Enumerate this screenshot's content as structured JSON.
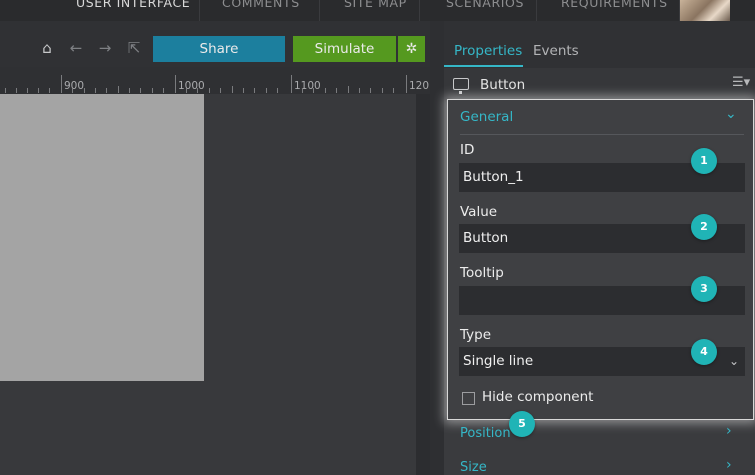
{
  "nav": {
    "tabs": [
      "USER INTERFACE",
      "COMMENTS",
      "SITE MAP",
      "SCENARIOS",
      "REQUIREMENTS"
    ],
    "active": "USER INTERFACE"
  },
  "toolbar": {
    "share_label": "Share",
    "simulate_label": "Simulate",
    "icons": [
      "home-icon",
      "back-arrow-icon",
      "forward-arrow-icon",
      "fit-to-screen-icon",
      "gear-icon"
    ]
  },
  "ruler": {
    "labels": [
      "900",
      "1000",
      "1100",
      "120"
    ]
  },
  "panel": {
    "tabs": [
      "Properties",
      "Events"
    ],
    "active_tab": "Properties",
    "component_name": "Button",
    "section_title": "General",
    "fields": {
      "id_label": "ID",
      "id_value": "Button_1",
      "value_label": "Value",
      "value_value": "Button",
      "tooltip_label": "Tooltip",
      "tooltip_value": "",
      "type_label": "Type",
      "type_value": "Single line",
      "hide_label": "Hide component",
      "hide_checked": false
    },
    "collapsed_sections": [
      "Position",
      "Size"
    ]
  },
  "badges": [
    "1",
    "2",
    "3",
    "4",
    "5"
  ],
  "colors": {
    "accent": "#35b7c7",
    "share": "#1c7f9e",
    "simulate": "#55991f",
    "badge": "#20b4b6"
  }
}
